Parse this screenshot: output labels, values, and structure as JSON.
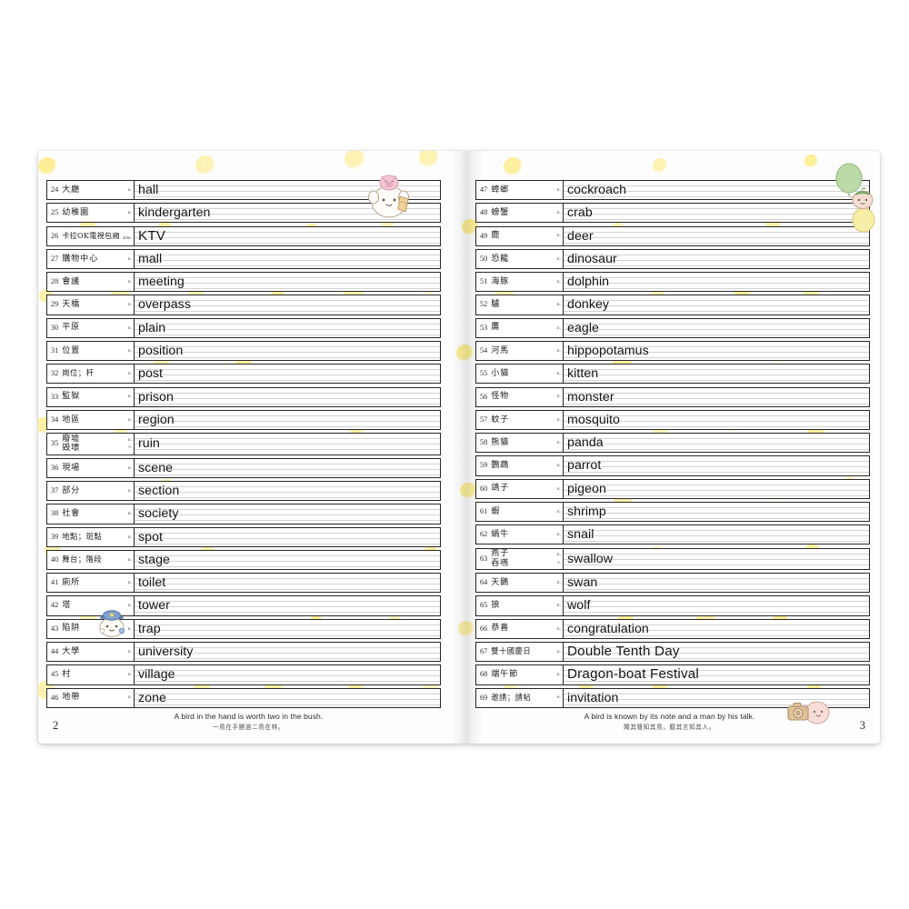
{
  "book": {
    "title": "English vocabulary handwriting practice workbook spread",
    "accent_dot_color": "#fbeb86",
    "ink_color": "#151515"
  },
  "left_page": {
    "page_number": "2",
    "rows": [
      {
        "num": "24",
        "cn": "大廳",
        "pos": "n.",
        "en": "hall"
      },
      {
        "num": "25",
        "cn": "幼稚園",
        "pos": "n.",
        "en": "kindergarten"
      },
      {
        "num": "26",
        "cn": "卡拉OK電視包廂",
        "pos": "abbr.",
        "en": "KTV",
        "cn_style": "small",
        "en_big": true
      },
      {
        "num": "27",
        "cn": "購物中心",
        "pos": "n.",
        "en": "mall"
      },
      {
        "num": "28",
        "cn": "會議",
        "pos": "n.",
        "en": "meeting"
      },
      {
        "num": "29",
        "cn": "天橋",
        "pos": "n.",
        "en": "overpass"
      },
      {
        "num": "30",
        "cn": "平原",
        "pos": "n.",
        "en": "plain"
      },
      {
        "num": "31",
        "cn": "位置",
        "pos": "n.",
        "en": "position"
      },
      {
        "num": "32",
        "cn": "崗位；杆",
        "pos": "n.",
        "en": "post",
        "cn_style": "tiny"
      },
      {
        "num": "33",
        "cn": "監獄",
        "pos": "n.",
        "en": "prison"
      },
      {
        "num": "34",
        "cn": "地區",
        "pos": "n.",
        "en": "region"
      },
      {
        "num": "35",
        "cn": "廢墟",
        "cn2": "毀壞",
        "pos": "n.",
        "pos2": "v.",
        "en": "ruin",
        "tall": true
      },
      {
        "num": "36",
        "cn": "現場",
        "pos": "n.",
        "en": "scene"
      },
      {
        "num": "37",
        "cn": "部分",
        "pos": "n.",
        "en": "section"
      },
      {
        "num": "38",
        "cn": "社會",
        "pos": "n.",
        "en": "society"
      },
      {
        "num": "39",
        "cn": "地點；斑點",
        "pos": "n.",
        "en": "spot",
        "cn_style": "tiny"
      },
      {
        "num": "40",
        "cn": "舞台；階段",
        "pos": "n.",
        "en": "stage",
        "cn_style": "tiny"
      },
      {
        "num": "41",
        "cn": "廁所",
        "pos": "n.",
        "en": "toilet"
      },
      {
        "num": "42",
        "cn": "塔",
        "pos": "n.",
        "en": "tower"
      },
      {
        "num": "43",
        "cn": "陷阱",
        "pos": "n.",
        "en": "trap"
      },
      {
        "num": "44",
        "cn": "大學",
        "pos": "n.",
        "en": "university"
      },
      {
        "num": "45",
        "cn": "村",
        "pos": "n.",
        "en": "village"
      },
      {
        "num": "46",
        "cn": "地帶",
        "pos": "n.",
        "en": "zone"
      }
    ],
    "footer": {
      "proverb_en": "A bird in the hand is worth two in the bush.",
      "proverb_cn": "一鳥在手勝過二鳥在林。"
    }
  },
  "right_page": {
    "page_number": "3",
    "rows": [
      {
        "num": "47",
        "cn": "蟑螂",
        "pos": "n.",
        "en": "cockroach"
      },
      {
        "num": "48",
        "cn": "螃蟹",
        "pos": "n.",
        "en": "crab"
      },
      {
        "num": "49",
        "cn": "鹿",
        "pos": "n.",
        "en": "deer"
      },
      {
        "num": "50",
        "cn": "恐龍",
        "pos": "n.",
        "en": "dinosaur"
      },
      {
        "num": "51",
        "cn": "海豚",
        "pos": "n.",
        "en": "dolphin"
      },
      {
        "num": "52",
        "cn": "驢",
        "pos": "n.",
        "en": "donkey"
      },
      {
        "num": "53",
        "cn": "鷹",
        "pos": "n.",
        "en": "eagle"
      },
      {
        "num": "54",
        "cn": "河馬",
        "pos": "n.",
        "en": "hippopotamus"
      },
      {
        "num": "55",
        "cn": "小貓",
        "pos": "n.",
        "en": "kitten"
      },
      {
        "num": "56",
        "cn": "怪物",
        "pos": "n.",
        "en": "monster"
      },
      {
        "num": "57",
        "cn": "蚊子",
        "pos": "n.",
        "en": "mosquito"
      },
      {
        "num": "58",
        "cn": "熊貓",
        "pos": "n.",
        "en": "panda"
      },
      {
        "num": "59",
        "cn": "鸚鵡",
        "pos": "n.",
        "en": "parrot"
      },
      {
        "num": "60",
        "cn": "鴿子",
        "pos": "n.",
        "en": "pigeon"
      },
      {
        "num": "61",
        "cn": "蝦",
        "pos": "n.",
        "en": "shrimp"
      },
      {
        "num": "62",
        "cn": "蝸牛",
        "pos": "n.",
        "en": "snail"
      },
      {
        "num": "63",
        "cn": "燕子",
        "cn2": "吞嚥",
        "pos": "n.",
        "pos2": "v.",
        "en": "swallow",
        "tall": true
      },
      {
        "num": "64",
        "cn": "天鵝",
        "pos": "n.",
        "en": "swan"
      },
      {
        "num": "65",
        "cn": "狼",
        "pos": "n.",
        "en": "wolf"
      },
      {
        "num": "66",
        "cn": "恭喜",
        "pos": "n.",
        "en": "congratulation"
      },
      {
        "num": "67",
        "cn": "雙十國慶日",
        "pos": "n.",
        "en": "Double Tenth Day",
        "cn_style": "tiny",
        "en_big": true
      },
      {
        "num": "68",
        "cn": "端午節",
        "pos": "n.",
        "en": "Dragon-boat Festival",
        "en_big": true
      },
      {
        "num": "69",
        "cn": "邀請；請帖",
        "pos": "n.",
        "en": "invitation",
        "cn_style": "tiny"
      }
    ],
    "footer": {
      "proverb_en": "A bird is known by its note and a man by his talk.",
      "proverb_cn": "聞其聲知其鳥，聽其言知其人。"
    }
  },
  "decorations": [
    {
      "name": "bear-with-pig-hat-icon",
      "page": "left",
      "description": "white bear character with small pink pig on its head holding a golden trophy"
    },
    {
      "name": "police-officer-icon",
      "page": "left",
      "description": "round character wearing a blue police cap"
    },
    {
      "name": "balloon-character-icon",
      "page": "right",
      "description": "character holding green and yellow balloons"
    },
    {
      "name": "camera-character-icon",
      "page": "right",
      "description": "pink character holding a brown camera"
    }
  ]
}
